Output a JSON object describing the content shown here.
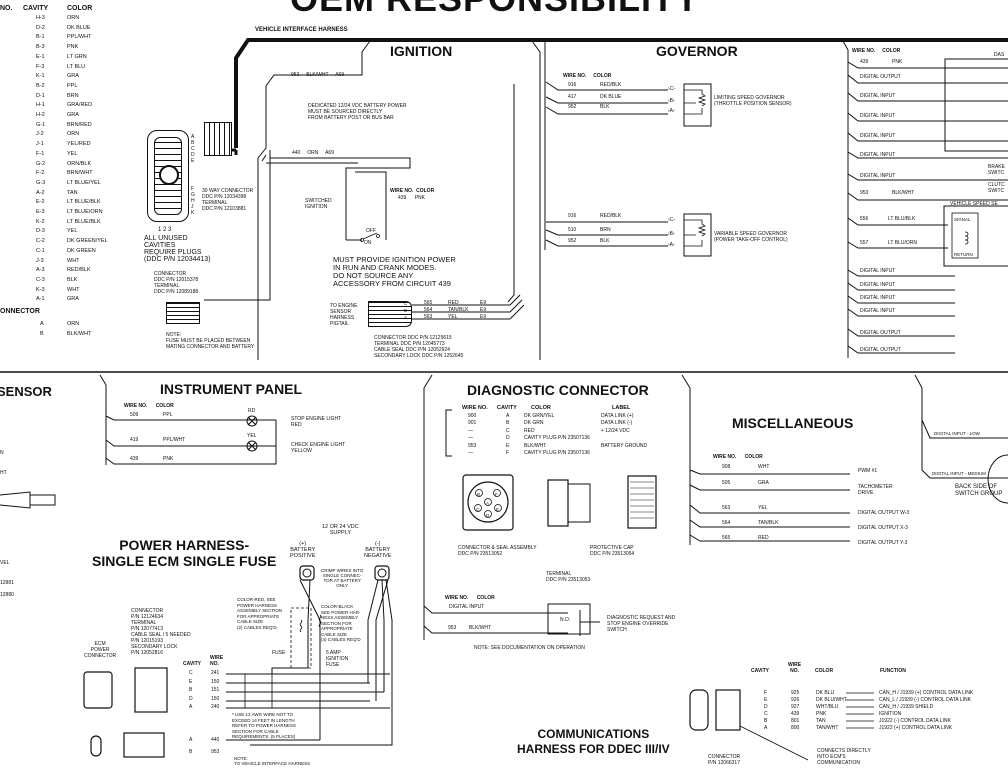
{
  "title": "OEM RESPONSIBILITY",
  "left_table": {
    "headers": [
      "NO.",
      "CAVITY",
      "COLOR"
    ],
    "rows": [
      {
        "cavity": "H-3",
        "color": "ORN"
      },
      {
        "cavity": "D-2",
        "color": "DK BLUE"
      },
      {
        "cavity": "B-1",
        "color": "PPL/WHT"
      },
      {
        "cavity": "B-3",
        "color": "PNK"
      },
      {
        "cavity": "E-1",
        "color": "LT GRN"
      },
      {
        "cavity": "F-3",
        "color": "LT BLU"
      },
      {
        "cavity": "K-1",
        "color": "GRA"
      },
      {
        "cavity": "B-2",
        "color": "PPL"
      },
      {
        "cavity": "D-1",
        "color": "BRN"
      },
      {
        "cavity": "H-1",
        "color": "GRA/RED"
      },
      {
        "cavity": "H-2",
        "color": "GRA"
      },
      {
        "cavity": "G-1",
        "color": "BRN/RED"
      },
      {
        "cavity": "J-2",
        "color": "ORN"
      },
      {
        "cavity": "J-1",
        "color": "YEL/RED"
      },
      {
        "cavity": "F-1",
        "color": "YEL"
      },
      {
        "cavity": "G-2",
        "color": "ORN/BLK"
      },
      {
        "cavity": "F-2",
        "color": "BRN/WHT"
      },
      {
        "cavity": "G-3",
        "color": "LT BLUE/YEL"
      },
      {
        "cavity": "A-2",
        "color": "TAN"
      },
      {
        "cavity": "E-2",
        "color": "LT BLUE/BLK"
      },
      {
        "cavity": "E-3",
        "color": "LT BLUE/ORN"
      },
      {
        "cavity": "K-2",
        "color": "LT BLUE/BLK"
      },
      {
        "cavity": "D-3",
        "color": "YEL"
      },
      {
        "cavity": "C-2",
        "color": "DK GREEN/YEL"
      },
      {
        "cavity": "C-1",
        "color": "DK GREEN"
      },
      {
        "cavity": "J-3",
        "color": "WHT"
      },
      {
        "cavity": "A-3",
        "color": "RED/BLK"
      },
      {
        "cavity": "C-3",
        "color": "BLK"
      },
      {
        "cavity": "K-3",
        "color": "WHT"
      },
      {
        "cavity": "A-1",
        "color": "GRA"
      }
    ],
    "connector_heading": "ONNECTOR",
    "connector_rows": [
      {
        "cavity": "A",
        "color": "ORN"
      },
      {
        "cavity": "B",
        "color": "BLK/WHT"
      }
    ]
  },
  "vehicle_harness": {
    "label": "VEHICLE INTERFACE HARNESS",
    "connector30_letters_top": [
      "A",
      "B",
      "C",
      "D",
      "E"
    ],
    "connector30_letters_bottom": [
      "F",
      "G",
      "H",
      "J",
      "K"
    ],
    "connector30_cols": "1 2 3",
    "connector30_note": [
      "30 WAY CONNECTOR",
      "DDC P/N 12034398",
      "TERMINAL",
      "DDC P/N 12103881"
    ],
    "unused_note": [
      "ALL UNUSED",
      "CAVITIES",
      "REQUIRE PLUGS",
      "(DDC P/N 12034413)"
    ],
    "small_connector_note": [
      "CONNECTOR",
      "DDC P/N 12015378",
      "TERMINAL",
      "DDC P/N 12089188"
    ],
    "fuse_note": [
      "NOTE:",
      "FUSE MUST BE PLACED BETWEEN",
      "MATING CONNECTOR AND BATTERY"
    ]
  },
  "ignition": {
    "heading": "IGNITION",
    "wire1": {
      "no": "953",
      "color": "BLK/WHT",
      "cavity": "A69"
    },
    "battery_note": [
      "DEDICATED 12/24 VDC BATTERY POWER",
      "MUST BE SOURCED DIRECTLY",
      "FROM BATTERY POST OR BUS BAR"
    ],
    "wire2": {
      "no": "440",
      "color": "ORN",
      "cavity": "A69"
    },
    "switched_label": [
      "SWITCHED",
      "IGNITION"
    ],
    "table_header": {
      "wire_no": "WIRE NO.",
      "color": "COLOR"
    },
    "table_row": {
      "no": "439",
      "color": "PNK"
    },
    "switch_off": "OFF",
    "switch_on": "ON",
    "power_note": [
      "MUST PROVIDE IGNITION POWER",
      "IN RUN AND CRANK MODES.",
      "DO NOT SOURCE ANY",
      "ACCESSORY FROM CIRCUIT 439"
    ],
    "pigtail_label": [
      "TO ENGINE",
      "SENSOR",
      "HARNESS",
      "PIGTAIL"
    ],
    "pigtail_wires": [
      {
        "no": "565",
        "color": "RED",
        "cavity": "E9",
        "pin": "C"
      },
      {
        "no": "564",
        "color": "TAN/BLK",
        "cavity": "E9",
        "pin": "B"
      },
      {
        "no": "563",
        "color": "YEL",
        "cavity": "E9",
        "pin": "A"
      }
    ],
    "pigtail_note": [
      "CONNECTOR DDC P/N 12129615",
      "TERMINAL DDC P/N 12045773",
      "CABLE SEAL DDC P/N 12052924",
      "SECONDARY LOCK DDC P/N 1252645"
    ]
  },
  "governor": {
    "heading": "GOVERNOR",
    "header": {
      "wire_no": "WIRE NO.",
      "color": "COLOR"
    },
    "limiting": {
      "wires": [
        {
          "no": "916",
          "color": "RED/BLK",
          "pin": "C"
        },
        {
          "no": "417",
          "color": "DK BLUE",
          "pin": "B"
        },
        {
          "no": "952",
          "color": "BLK",
          "pin": "A"
        }
      ],
      "label": [
        "LIMITING SPEED GOVERNOR",
        "(THROTTLE POSITION SENSOR)"
      ]
    },
    "variable": {
      "wires": [
        {
          "no": "916",
          "color": "RED/BLK",
          "pin": "C"
        },
        {
          "no": "510",
          "color": "BRN",
          "pin": "B"
        },
        {
          "no": "952",
          "color": "BLK",
          "pin": "A"
        }
      ],
      "label": [
        "VARIABLE SPEED GOVERNOR",
        "(POWER TAKE-OFF CONTROL)"
      ]
    }
  },
  "right_panel": {
    "header": {
      "wire_no": "WIRE NO.",
      "color": "COLOR"
    },
    "dash_label": "DAS",
    "rows": [
      {
        "label": "439",
        "color": "PNK"
      },
      {
        "label": "DIGITAL OUTPUT",
        "color": ""
      },
      {
        "label": "DIGITAL INPUT",
        "color": ""
      },
      {
        "label": "DIGITAL INPUT",
        "color": ""
      },
      {
        "label": "DIGITAL INPUT",
        "color": ""
      },
      {
        "label": "DIGITAL INPUT",
        "color": ""
      },
      {
        "label": "DIGITAL INPUT",
        "color": ""
      },
      {
        "label": "953",
        "color": "BLK/WHT"
      }
    ],
    "brake_label": [
      "BRAKE",
      "SWITC"
    ],
    "clutch_label": [
      "CLUTC",
      "SWITC"
    ],
    "vss_label": "VEHICLE SPEED SE",
    "vss_rows": [
      {
        "no": "556",
        "color": "LT BLU/BLK"
      },
      {
        "no": "557",
        "color": "LT BLU/ORN"
      }
    ],
    "vss_signal": "SIGNAL",
    "vss_return": "RETURN",
    "bottom_rows": [
      "DIGITAL INPUT",
      "DIGITAL INPUT",
      "DIGITAL INPUT",
      "DIGITAL INPUT",
      "DIGITAL OUTPUT",
      "DIGITAL OUTPUT"
    ]
  },
  "sensor_section": {
    "heading": "SENSOR",
    "fragments": [
      "N",
      "HT",
      "VEL",
      "12881",
      "12880"
    ]
  },
  "instrument_panel": {
    "heading": "INSTRUMENT PANEL",
    "header": {
      "wire_no": "WIRE NO.",
      "color": "COLOR"
    },
    "wires": [
      {
        "no": "509",
        "color": "PPL"
      },
      {
        "no": "419",
        "color": "PPL/WHT"
      },
      {
        "no": "439",
        "color": "PNK"
      }
    ],
    "lamps": [
      {
        "tag": "RD",
        "label": [
          "STOP ENGINE LIGHT",
          "RED"
        ]
      },
      {
        "tag": "YEL",
        "label": [
          "CHECK ENGINE LIGHT",
          "YELLOW"
        ]
      }
    ]
  },
  "power_harness": {
    "heading": [
      "POWER HARNESS-",
      "SINGLE ECM SINGLE FUSE"
    ],
    "supply": [
      "12 OR 24 VDC",
      "SUPPLY"
    ],
    "battery_pos": [
      "(+)",
      "BATTERY",
      "POSITIVE"
    ],
    "battery_neg": [
      "(-)",
      "BATTERY",
      "NEGATIVE"
    ],
    "crimp_note": [
      "CRIMP WIRES INTO",
      "SINGLE CONNEC-",
      "TOR AT BATTERY",
      "ONLY"
    ],
    "red_note": [
      "COLOR-RED, SEE",
      "POWER HARNESS",
      "ASSEMBLY SECTION",
      "FOR APPROPRIATE",
      "CABLE SIZE",
      "(2) CABLES REQ'D."
    ],
    "black_note": [
      "COLOR-BLACK",
      "SEE POWER HAR-",
      "NESS ASSEMBLY",
      "SECTION FOR",
      "APPROPRIATE",
      "CABLE SIZE",
      "(4) CABLES REQ'D"
    ],
    "fuse_label": "FUSE",
    "ign_fuse": [
      "5 AMP",
      "IGNITION",
      "FUSE"
    ],
    "connector_note": [
      "CONNECTOR",
      "P/N 12124634",
      "TERMINAL",
      "P/N 12077413",
      "CABLE SEAL / 5 NEEDED",
      "P/N 12015193",
      "SECONDARY LOCK",
      "P/N 12052816"
    ],
    "ecm_label": [
      "ECM",
      "POWER",
      "CONNECTOR"
    ],
    "col_cavity": "CAVITY",
    "col_wire": [
      "WIRE",
      "NO."
    ],
    "rows": [
      {
        "cavity": "C",
        "wire": "241"
      },
      {
        "cavity": "E",
        "wire": "150"
      },
      {
        "cavity": "B",
        "wire": "151"
      },
      {
        "cavity": "D",
        "wire": "150"
      },
      {
        "cavity": "A",
        "wire": "240"
      }
    ],
    "awg_note": [
      "* USE 12 AWG WIRE NOT TO",
      "EXCEED 14 FEET IN LENGTH",
      "REFER TO POWER HARNESS",
      "SECTION FOR CABLE",
      "REQUIREMENTS. (5 PLACES)"
    ],
    "rows2": [
      {
        "cavity": "A",
        "wire": "440"
      },
      {
        "cavity": "B",
        "wire": "953"
      }
    ],
    "bottom_note": [
      "NOTE:",
      "TO VEHICLE INTERFACE HARNESS"
    ]
  },
  "diagnostic": {
    "heading": "DIAGNOSTIC CONNECTOR",
    "headers": [
      "WIRE NO.",
      "CAVITY",
      "COLOR",
      "LABEL"
    ],
    "rows": [
      {
        "no": "900",
        "cavity": "A",
        "color": "DK GRN/YEL",
        "label": "DATA LINK (+)"
      },
      {
        "no": "901",
        "cavity": "B",
        "color": "DK GRN",
        "label": "DATA LINK (-)"
      },
      {
        "no": "—",
        "cavity": "C",
        "color": "RED",
        "label": "+ 12/24 VDC"
      },
      {
        "no": "—",
        "cavity": "D",
        "color": "CAVITY PLUG P/N 23507136",
        "label": ""
      },
      {
        "no": "953",
        "cavity": "E",
        "color": "BLK/WHT",
        "label": "BATTERY GROUND"
      },
      {
        "no": "—",
        "cavity": "F",
        "color": "CAVITY PLUG P/N 23507136",
        "label": ""
      }
    ],
    "pins": [
      "A",
      "B",
      "C",
      "D",
      "E",
      "F"
    ],
    "seal_note": [
      "CONNECTOR & SEAL ASSEMBLY",
      "DDC P/N 23513052"
    ],
    "cap_note": [
      "PROTECTIVE CAP",
      "DDC P/N 23513054"
    ],
    "terminal_note": [
      "TERMINAL",
      "DDC P/N 23513053"
    ],
    "switch_header": {
      "wire_no": "WIRE NO.",
      "color": "COLOR"
    },
    "switch_rows": [
      {
        "no": "DIGITAL INPUT",
        "color": ""
      },
      {
        "no": "953",
        "color": "BLK/WHT"
      }
    ],
    "switch_no": "N.O.",
    "switch_label": [
      "DIAGNOSTIC REQUEST AND",
      "STOP ENGINE OVERRIDE",
      "SWITCH"
    ],
    "doc_note": "NOTE: SEE DOCUMENTATION ON OPERATION"
  },
  "misc": {
    "heading": "MISCELLANEOUS",
    "header": {
      "wire_no": "WIRE NO.",
      "color": "COLOR"
    },
    "rows": [
      {
        "no": "908",
        "color": "WHT",
        "function": [
          "PWM #1"
        ]
      },
      {
        "no": "505",
        "color": "GRA",
        "function": [
          "TACHOMETER",
          "DRIVE"
        ]
      },
      {
        "no": "563",
        "color": "YEL",
        "function": [
          "DIGITAL OUTPUT W-3"
        ]
      },
      {
        "no": "564",
        "color": "TAN/BLK",
        "function": [
          "DIGITAL OUTPUT X-3"
        ]
      },
      {
        "no": "565",
        "color": "RED",
        "function": [
          "DIGITAL OUTPUT Y-3"
        ]
      }
    ]
  },
  "switch_group": {
    "low": "DIGITAL INPUT - LOW",
    "medium": "DIGITAL INPUT - MEDIUM",
    "label": [
      "BACK SIDE OF",
      "SWITCH GROUP"
    ]
  },
  "communications": {
    "heading": [
      "COMMUNICATIONS",
      "HARNESS FOR DDEC III/IV"
    ],
    "headers": {
      "cavity": "CAVITY",
      "wire": [
        "WIRE",
        "NO."
      ],
      "color": "COLOR",
      "function": "FUNCTION"
    },
    "rows": [
      {
        "cavity": "F",
        "no": "925",
        "color": "DK BLU",
        "function": "CAN_H / J1939 (+) CONTROL DATA LINK"
      },
      {
        "cavity": "E",
        "no": "926",
        "color": "DK BLU/WHT",
        "function": "CAN_L / J1939 (-) CONTROL DATA LINK"
      },
      {
        "cavity": "D",
        "no": "927",
        "color": "WHT/BLU",
        "function": "CAN_H / J1939 SHIELD"
      },
      {
        "cavity": "C",
        "no": "439",
        "color": "PNK",
        "function": "IGNITION"
      },
      {
        "cavity": "B",
        "no": "801",
        "color": "TAN",
        "function": "J1922 (-) CONTROL DATA LINK"
      },
      {
        "cavity": "A",
        "no": "800",
        "color": "TAN/WHT",
        "function": "J1922 (+) CONTROL DATA LINK"
      }
    ],
    "connector_note": [
      "CONNECTOR",
      "P/N 12066317"
    ],
    "ecm_note": [
      "CONNECTS DIRECTLY",
      "INTO ECM'S",
      "COMMUNICATION"
    ]
  }
}
